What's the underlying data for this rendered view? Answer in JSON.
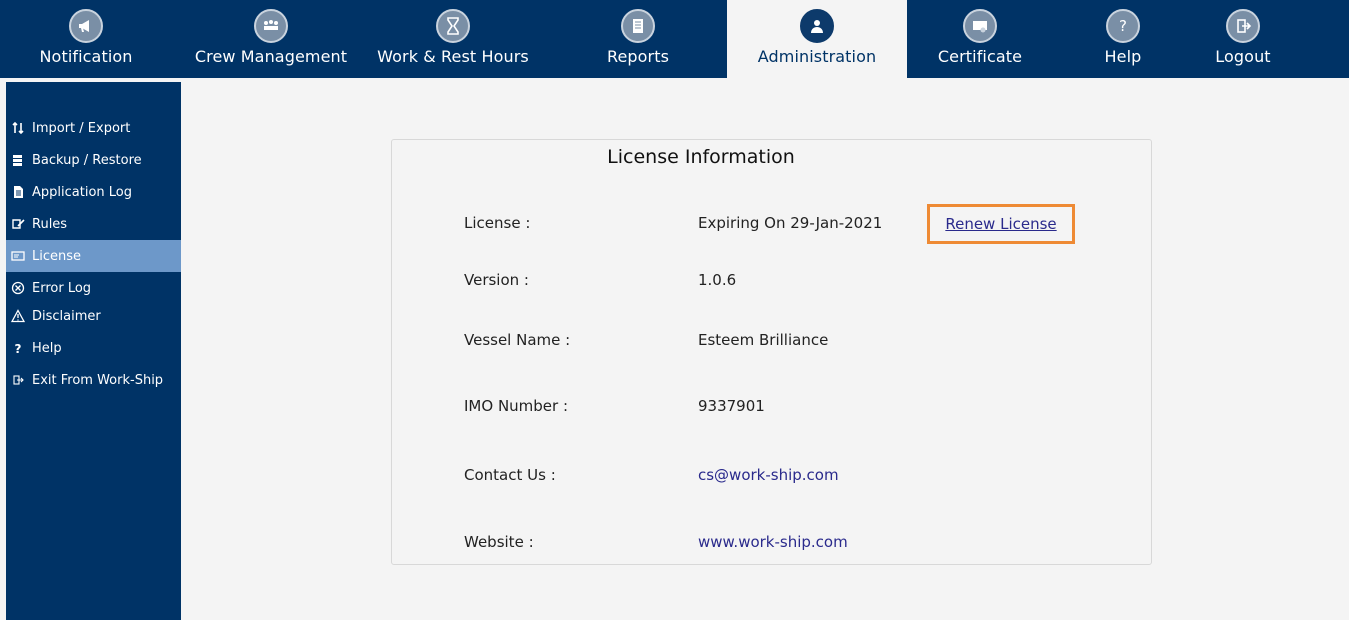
{
  "topnav": {
    "items": [
      {
        "label": "Notification",
        "icon": "megaphone-icon"
      },
      {
        "label": "Crew Management",
        "icon": "crew-icon"
      },
      {
        "label": "Work & Rest Hours",
        "icon": "hourglass-icon"
      },
      {
        "label": "Reports",
        "icon": "reports-icon"
      },
      {
        "label": "Administration",
        "icon": "admin-user-icon"
      },
      {
        "label": "Certificate",
        "icon": "certificate-icon"
      },
      {
        "label": "Help",
        "icon": "question-icon"
      },
      {
        "label": "Logout",
        "icon": "logout-icon"
      }
    ],
    "active": "Administration"
  },
  "sidebar": {
    "items": [
      {
        "label": "Import / Export",
        "icon": "import-export-icon"
      },
      {
        "label": "Backup / Restore",
        "icon": "backup-icon"
      },
      {
        "label": "Application Log",
        "icon": "document-icon"
      },
      {
        "label": "Rules",
        "icon": "rules-icon"
      },
      {
        "label": "License",
        "icon": "license-icon"
      },
      {
        "label": "Error Log",
        "icon": "error-icon"
      },
      {
        "label": "Disclaimer",
        "icon": "warning-icon"
      },
      {
        "label": "Help",
        "icon": "question-icon"
      },
      {
        "label": "Exit From Work-Ship",
        "icon": "exit-icon"
      }
    ],
    "active": "License"
  },
  "license_panel": {
    "title": "License Information",
    "rows": [
      {
        "label": "License :",
        "value": "Expiring On 29-Jan-2021"
      },
      {
        "label": "Version :",
        "value": "1.0.6"
      },
      {
        "label": "Vessel Name :",
        "value": "Esteem Brilliance"
      },
      {
        "label": "IMO Number :",
        "value": "9337901"
      },
      {
        "label": "Contact Us :",
        "value": "cs@work-ship.com"
      },
      {
        "label": "Website :",
        "value": "www.work-ship.com"
      }
    ],
    "renew_link": "Renew License"
  },
  "colors": {
    "navy": "#003366",
    "active_sidebar": "#6d98c9",
    "highlight_border": "#ee8a34",
    "link": "#2a2a8c",
    "background": "#f4f4f4"
  }
}
